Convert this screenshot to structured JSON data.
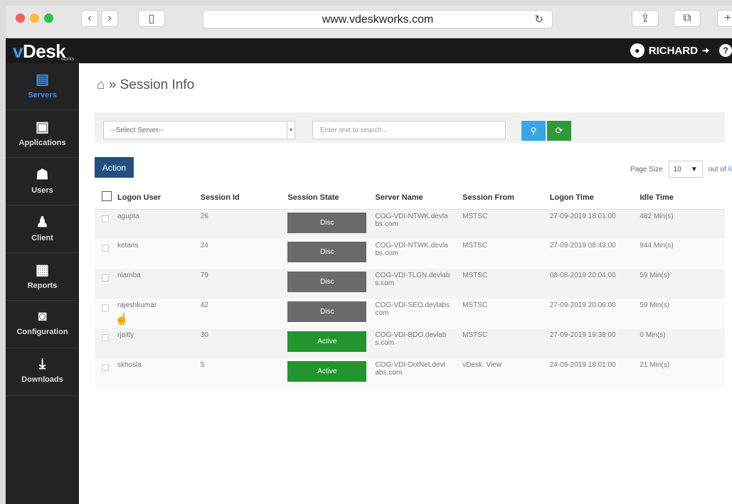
{
  "browser": {
    "url": "www.vdeskworks.com"
  },
  "app": {
    "logo_main": "Desk",
    "logo_v": "v",
    "logo_sub": "works",
    "user_name": "RICHARD"
  },
  "sidebar": {
    "items": [
      {
        "label": "Servers",
        "icon": "servers-icon",
        "active": true
      },
      {
        "label": "Applications",
        "icon": "applications-icon"
      },
      {
        "label": "Users",
        "icon": "users-icon"
      },
      {
        "label": "Client",
        "icon": "client-icon"
      },
      {
        "label": "Reports",
        "icon": "reports-icon"
      },
      {
        "label": "Configuration",
        "icon": "configuration-icon"
      },
      {
        "label": "Downloads",
        "icon": "downloads-icon"
      }
    ]
  },
  "page": {
    "breadcrumb_sep": "»",
    "title": "Session Info"
  },
  "toolbar": {
    "server_select": "--Select Server--",
    "search_placeholder": "Enter text to search..."
  },
  "actions": {
    "action_label": "Action",
    "page_size_label": "Page Size",
    "page_size_value": "10",
    "out_of": "out of",
    "out_of_value": "6"
  },
  "table": {
    "headers": [
      "Logon User",
      "Session Id",
      "Session State",
      "Server Name",
      "Session From",
      "Logon Time",
      "Idle Time"
    ],
    "rows": [
      {
        "user": "agupta",
        "id": "26",
        "state": "Disc",
        "server": "COG-VDI-NTWK.devla bs.com",
        "from": "MSTSC",
        "logon": "27-09-2019 18:01:00",
        "idle": "482 Min(s)"
      },
      {
        "user": "ketans",
        "id": "24",
        "state": "Disc",
        "server": "COG-VDI-NTWK.devla bs.com",
        "from": "MSTSC",
        "logon": "27-09-2019 08:43:00",
        "idle": "944 Min(s)"
      },
      {
        "user": "nlamba",
        "id": "79",
        "state": "Disc",
        "server": "COG-VDI-TLGN.devlab s.com",
        "from": "MSTSC",
        "logon": "08-08-2019 20:04:00",
        "idle": "59 Min(s)"
      },
      {
        "user": "rajeshkumar",
        "id": "42",
        "state": "Disc",
        "server": "COG-VDI-SEO.devlabs. com",
        "from": "MSTSC",
        "logon": "27-09-2019 20:06:00",
        "idle": "59 Min(s)"
      },
      {
        "user": "rjaitly",
        "id": "30",
        "state": "Active",
        "server": "COG-VDI-BDO.devlab s.com",
        "from": "MSTSC",
        "logon": "27-09-2019 19:38:00",
        "idle": "0 Min(s)"
      },
      {
        "user": "skhosla",
        "id": "5",
        "state": "Active",
        "server": "COG-VDI-DotNet.devl abs.com",
        "from": "vDesk. View",
        "logon": "24-09-2019 18:01:00",
        "idle": "21 Min(s)"
      }
    ]
  },
  "colors": {
    "accent": "#3a8ee0",
    "action_button": "#234f80",
    "state_disc": "#6a6a6a",
    "state_active": "#23952f"
  }
}
